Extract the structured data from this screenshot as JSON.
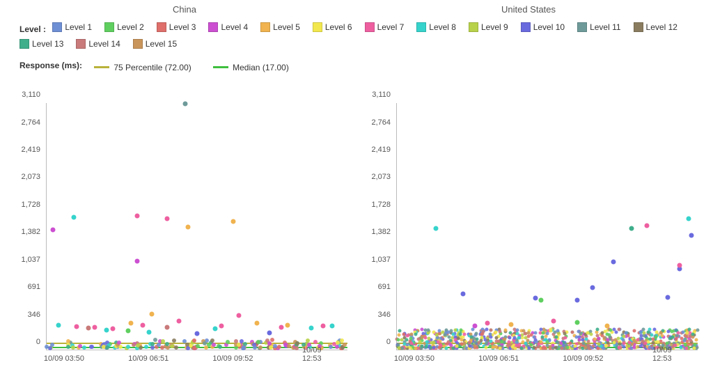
{
  "titles": {
    "left": "China",
    "right": "United States"
  },
  "level_legend": {
    "label": "Level :",
    "items": [
      {
        "name": "Level 1",
        "color": "#6e8fd4"
      },
      {
        "name": "Level 2",
        "color": "#5fcf5f"
      },
      {
        "name": "Level 3",
        "color": "#de6f6a"
      },
      {
        "name": "Level 4",
        "color": "#cc4fd1"
      },
      {
        "name": "Level 5",
        "color": "#f0b34f"
      },
      {
        "name": "Level 6",
        "color": "#f2e84e"
      },
      {
        "name": "Level 7",
        "color": "#ee5fa0"
      },
      {
        "name": "Level 8",
        "color": "#36d3cc"
      },
      {
        "name": "Level 9",
        "color": "#b8d24a"
      },
      {
        "name": "Level 10",
        "color": "#6a6adf"
      },
      {
        "name": "Level 11",
        "color": "#6f9a9a"
      },
      {
        "name": "Level 12",
        "color": "#8a7c5f"
      },
      {
        "name": "Level 13",
        "color": "#3fae8b"
      },
      {
        "name": "Level 14",
        "color": "#c97a7a"
      },
      {
        "name": "Level 15",
        "color": "#c9955a"
      }
    ]
  },
  "response_legend": {
    "label": "Response (ms):",
    "p75": {
      "text": "75 Percentile (72.00)",
      "color": "#b8b23a",
      "value": 72.0
    },
    "median": {
      "text": "Median (17.00)",
      "color": "#3fbf3f",
      "value": 17.0
    }
  },
  "chart_data": [
    {
      "type": "scatter",
      "title": "China",
      "ylabel": "Response (ms)",
      "ylim": [
        0,
        3110
      ],
      "y_ticks": [
        0,
        346,
        691,
        1037,
        1382,
        1728,
        2073,
        2419,
        2764,
        3110
      ],
      "x_ticks": [
        "10/09 03:50",
        "10/09 06:51",
        "10/09 09:52",
        "10/09 12:53"
      ],
      "reference_lines": [
        {
          "name": "p75",
          "value": 72.0,
          "color": "#b8b23a"
        },
        {
          "name": "median",
          "value": 17.0,
          "color": "#3fbf3f"
        }
      ],
      "series_note": "x is fractional position 0..1 across the visible time range; y is response ms",
      "series": [
        {
          "name": "Level 4",
          "color": "#cc4fd1",
          "points": [
            {
              "x": 0.02,
              "y": 1510
            },
            {
              "x": 0.3,
              "y": 1120
            }
          ]
        },
        {
          "name": "Level 8",
          "color": "#36d3cc",
          "points": [
            {
              "x": 0.09,
              "y": 1670
            },
            {
              "x": 0.04,
              "y": 310
            },
            {
              "x": 0.2,
              "y": 250
            },
            {
              "x": 0.34,
              "y": 220
            },
            {
              "x": 0.56,
              "y": 260
            },
            {
              "x": 0.88,
              "y": 270
            },
            {
              "x": 0.95,
              "y": 300
            }
          ]
        },
        {
          "name": "Level 7",
          "color": "#ee5fa0",
          "points": [
            {
              "x": 0.3,
              "y": 1690
            },
            {
              "x": 0.4,
              "y": 1650
            },
            {
              "x": 0.1,
              "y": 290
            },
            {
              "x": 0.16,
              "y": 280
            },
            {
              "x": 0.22,
              "y": 260
            },
            {
              "x": 0.32,
              "y": 310
            },
            {
              "x": 0.44,
              "y": 360
            },
            {
              "x": 0.58,
              "y": 300
            },
            {
              "x": 0.64,
              "y": 430
            },
            {
              "x": 0.78,
              "y": 280
            },
            {
              "x": 0.92,
              "y": 300
            }
          ]
        },
        {
          "name": "Level 5",
          "color": "#f0b34f",
          "points": [
            {
              "x": 0.47,
              "y": 1550
            },
            {
              "x": 0.62,
              "y": 1620
            },
            {
              "x": 0.28,
              "y": 330
            },
            {
              "x": 0.7,
              "y": 330
            },
            {
              "x": 0.8,
              "y": 310
            },
            {
              "x": 0.35,
              "y": 450
            }
          ]
        },
        {
          "name": "Level 11",
          "color": "#6f9a9a",
          "points": [
            {
              "x": 0.46,
              "y": 3100
            }
          ]
        },
        {
          "name": "Level 2",
          "color": "#5fcf5f",
          "points": [
            {
              "x": 0.27,
              "y": 240
            }
          ]
        },
        {
          "name": "Level 14",
          "color": "#c97a7a",
          "points": [
            {
              "x": 0.14,
              "y": 270
            },
            {
              "x": 0.4,
              "y": 280
            }
          ]
        },
        {
          "name": "Level 10",
          "color": "#6a6adf",
          "points": [
            {
              "x": 0.5,
              "y": 200
            },
            {
              "x": 0.74,
              "y": 210
            }
          ]
        }
      ],
      "baseline_cluster": {
        "count": 180,
        "y_range": [
          20,
          120
        ]
      }
    },
    {
      "type": "scatter",
      "title": "United States",
      "ylabel": "Response (ms)",
      "ylim": [
        0,
        3110
      ],
      "y_ticks": [
        0,
        346,
        691,
        1037,
        1382,
        1728,
        2073,
        2419,
        2764,
        3110
      ],
      "x_ticks": [
        "10/09 03:50",
        "10/09 06:51",
        "10/09 09:52",
        "10/09 12:53"
      ],
      "reference_lines": [
        {
          "name": "p75",
          "value": 72.0,
          "color": "#b8b23a"
        },
        {
          "name": "median",
          "value": 17.0,
          "color": "#3fbf3f"
        }
      ],
      "series": [
        {
          "name": "Level 8",
          "color": "#36d3cc",
          "points": [
            {
              "x": 0.13,
              "y": 1530
            },
            {
              "x": 0.97,
              "y": 1650
            }
          ]
        },
        {
          "name": "Level 10",
          "color": "#6a6adf",
          "points": [
            {
              "x": 0.22,
              "y": 700
            },
            {
              "x": 0.46,
              "y": 650
            },
            {
              "x": 0.6,
              "y": 620
            },
            {
              "x": 0.65,
              "y": 780
            },
            {
              "x": 0.72,
              "y": 1110
            },
            {
              "x": 0.9,
              "y": 660
            },
            {
              "x": 0.94,
              "y": 1020
            },
            {
              "x": 0.98,
              "y": 1440
            }
          ]
        },
        {
          "name": "Level 7",
          "color": "#ee5fa0",
          "points": [
            {
              "x": 0.83,
              "y": 1560
            },
            {
              "x": 0.94,
              "y": 1060
            },
            {
              "x": 0.3,
              "y": 330
            },
            {
              "x": 0.52,
              "y": 360
            }
          ]
        },
        {
          "name": "Level 13",
          "color": "#3fae8b",
          "points": [
            {
              "x": 0.78,
              "y": 1530
            }
          ]
        },
        {
          "name": "Level 2",
          "color": "#5fcf5f",
          "points": [
            {
              "x": 0.48,
              "y": 620
            },
            {
              "x": 0.6,
              "y": 340
            }
          ]
        },
        {
          "name": "Level 5",
          "color": "#f0b34f",
          "points": [
            {
              "x": 0.38,
              "y": 320
            },
            {
              "x": 0.7,
              "y": 300
            }
          ]
        },
        {
          "name": "Level 4",
          "color": "#cc4fd1",
          "points": [
            {
              "x": 0.26,
              "y": 300
            }
          ]
        }
      ],
      "baseline_cluster": {
        "count": 900,
        "y_range": [
          15,
          260
        ]
      }
    }
  ]
}
